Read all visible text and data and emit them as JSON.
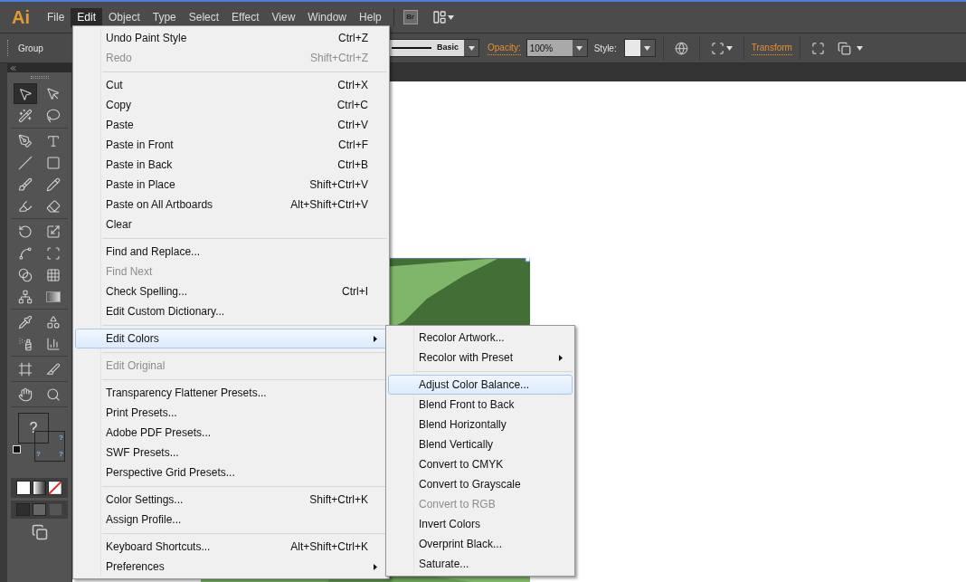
{
  "menubar": {
    "logo": "Ai",
    "items": [
      {
        "label": "File",
        "selected": false
      },
      {
        "label": "Edit",
        "selected": true
      },
      {
        "label": "Object",
        "selected": false
      },
      {
        "label": "Type",
        "selected": false
      },
      {
        "label": "Select",
        "selected": false
      },
      {
        "label": "Effect",
        "selected": false
      },
      {
        "label": "View",
        "selected": false
      },
      {
        "label": "Window",
        "selected": false
      },
      {
        "label": "Help",
        "selected": false
      }
    ],
    "bridge_button": "Br"
  },
  "control_bar": {
    "selection_label": "Group",
    "stroke_profile": "Basic",
    "opacity_label": "Opacity:",
    "opacity_value": "100%",
    "style_label": "Style:",
    "transform_link": "Transform"
  },
  "toolbox": {
    "tools": [
      {
        "selected": true
      },
      {
        "selected": false
      },
      {
        "selected": false
      },
      {
        "selected": false
      },
      {
        "selected": false
      },
      {
        "selected": false
      },
      {
        "selected": false
      },
      {
        "selected": false
      },
      {
        "selected": false
      },
      {
        "selected": false
      },
      {
        "selected": false
      },
      {
        "selected": false
      },
      {
        "selected": false
      },
      {
        "selected": false
      },
      {
        "selected": false
      },
      {
        "selected": false
      },
      {
        "selected": false
      },
      {
        "selected": false
      },
      {
        "selected": false
      },
      {
        "selected": false
      },
      {
        "selected": false
      },
      {
        "selected": false
      },
      {
        "selected": false
      },
      {
        "selected": false
      },
      {
        "selected": false
      },
      {
        "selected": false
      },
      {
        "selected": false
      },
      {
        "selected": false
      }
    ],
    "fill": "?",
    "stroke_marks": [
      "?",
      "?",
      "?"
    ]
  },
  "edit_menu": {
    "items": [
      {
        "kind": "item",
        "label": "Undo Paint Style",
        "shortcut": "Ctrl+Z",
        "disabled": false,
        "selected": false,
        "has_submenu": false
      },
      {
        "kind": "item",
        "label": "Redo",
        "shortcut": "Shift+Ctrl+Z",
        "disabled": true,
        "selected": false,
        "has_submenu": false
      },
      {
        "kind": "separator"
      },
      {
        "kind": "item",
        "label": "Cut",
        "shortcut": "Ctrl+X",
        "disabled": false,
        "selected": false,
        "has_submenu": false
      },
      {
        "kind": "item",
        "label": "Copy",
        "shortcut": "Ctrl+C",
        "disabled": false,
        "selected": false,
        "has_submenu": false
      },
      {
        "kind": "item",
        "label": "Paste",
        "shortcut": "Ctrl+V",
        "disabled": false,
        "selected": false,
        "has_submenu": false
      },
      {
        "kind": "item",
        "label": "Paste in Front",
        "shortcut": "Ctrl+F",
        "disabled": false,
        "selected": false,
        "has_submenu": false
      },
      {
        "kind": "item",
        "label": "Paste in Back",
        "shortcut": "Ctrl+B",
        "disabled": false,
        "selected": false,
        "has_submenu": false
      },
      {
        "kind": "item",
        "label": "Paste in Place",
        "shortcut": "Shift+Ctrl+V",
        "disabled": false,
        "selected": false,
        "has_submenu": false
      },
      {
        "kind": "item",
        "label": "Paste on All Artboards",
        "shortcut": "Alt+Shift+Ctrl+V",
        "disabled": false,
        "selected": false,
        "has_submenu": false
      },
      {
        "kind": "item",
        "label": "Clear",
        "disabled": false,
        "selected": false,
        "has_submenu": false
      },
      {
        "kind": "separator"
      },
      {
        "kind": "item",
        "label": "Find and Replace...",
        "disabled": false,
        "selected": false,
        "has_submenu": false
      },
      {
        "kind": "item",
        "label": "Find Next",
        "disabled": true,
        "selected": false,
        "has_submenu": false
      },
      {
        "kind": "item",
        "label": "Check Spelling...",
        "shortcut": "Ctrl+I",
        "disabled": false,
        "selected": false,
        "has_submenu": false
      },
      {
        "kind": "item",
        "label": "Edit Custom Dictionary...",
        "disabled": false,
        "selected": false,
        "has_submenu": false
      },
      {
        "kind": "separator"
      },
      {
        "kind": "item",
        "label": "Edit Colors",
        "disabled": false,
        "selected": true,
        "has_submenu": true
      },
      {
        "kind": "separator"
      },
      {
        "kind": "item",
        "label": "Edit Original",
        "disabled": true,
        "selected": false,
        "has_submenu": false
      },
      {
        "kind": "separator"
      },
      {
        "kind": "item",
        "label": "Transparency Flattener Presets...",
        "disabled": false,
        "selected": false,
        "has_submenu": false
      },
      {
        "kind": "item",
        "label": "Print Presets...",
        "disabled": false,
        "selected": false,
        "has_submenu": false
      },
      {
        "kind": "item",
        "label": "Adobe PDF Presets...",
        "disabled": false,
        "selected": false,
        "has_submenu": false
      },
      {
        "kind": "item",
        "label": "SWF Presets...",
        "disabled": false,
        "selected": false,
        "has_submenu": false
      },
      {
        "kind": "item",
        "label": "Perspective Grid Presets...",
        "disabled": false,
        "selected": false,
        "has_submenu": false
      },
      {
        "kind": "separator"
      },
      {
        "kind": "item",
        "label": "Color Settings...",
        "shortcut": "Shift+Ctrl+K",
        "disabled": false,
        "selected": false,
        "has_submenu": false
      },
      {
        "kind": "item",
        "label": "Assign Profile...",
        "disabled": false,
        "selected": false,
        "has_submenu": false
      },
      {
        "kind": "separator"
      },
      {
        "kind": "item",
        "label": "Keyboard Shortcuts...",
        "shortcut": "Alt+Shift+Ctrl+K",
        "disabled": false,
        "selected": false,
        "has_submenu": false
      },
      {
        "kind": "item",
        "label": "Preferences",
        "disabled": false,
        "selected": false,
        "has_submenu": true
      }
    ]
  },
  "edit_colors_submenu": {
    "items": [
      {
        "kind": "item",
        "label": "Recolor Artwork...",
        "disabled": false,
        "selected": false,
        "has_submenu": false
      },
      {
        "kind": "item",
        "label": "Recolor with Preset",
        "disabled": false,
        "selected": false,
        "has_submenu": true
      },
      {
        "kind": "separator"
      },
      {
        "kind": "item",
        "label": "Adjust Color Balance...",
        "disabled": false,
        "selected": true,
        "has_submenu": false
      },
      {
        "kind": "item",
        "label": "Blend Front to Back",
        "disabled": false,
        "selected": false,
        "has_submenu": false
      },
      {
        "kind": "item",
        "label": "Blend Horizontally",
        "disabled": false,
        "selected": false,
        "has_submenu": false
      },
      {
        "kind": "item",
        "label": "Blend Vertically",
        "disabled": false,
        "selected": false,
        "has_submenu": false
      },
      {
        "kind": "item",
        "label": "Convert to CMYK",
        "disabled": false,
        "selected": false,
        "has_submenu": false
      },
      {
        "kind": "item",
        "label": "Convert to Grayscale",
        "disabled": false,
        "selected": false,
        "has_submenu": false
      },
      {
        "kind": "item",
        "label": "Convert to RGB",
        "disabled": true,
        "selected": false,
        "has_submenu": false
      },
      {
        "kind": "item",
        "label": "Invert Colors",
        "disabled": false,
        "selected": false,
        "has_submenu": false
      },
      {
        "kind": "item",
        "label": "Overprint Black...",
        "disabled": false,
        "selected": false,
        "has_submenu": false
      },
      {
        "kind": "item",
        "label": "Saturate...",
        "disabled": false,
        "selected": false,
        "has_submenu": false
      }
    ]
  }
}
